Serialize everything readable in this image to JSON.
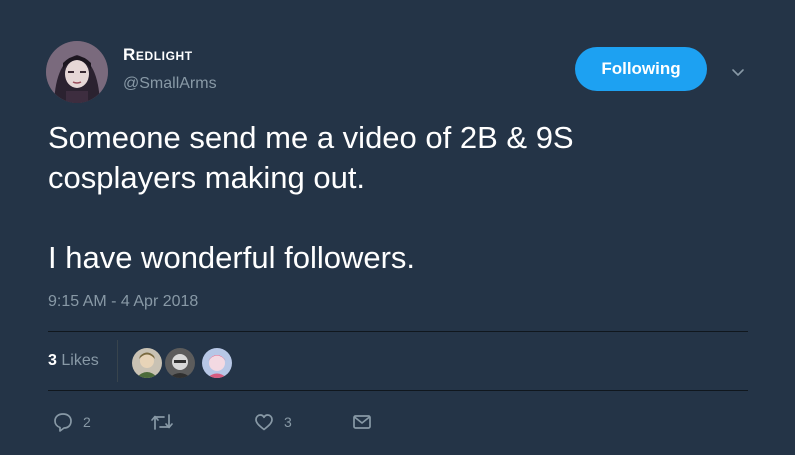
{
  "user": {
    "display_name": "Redlight",
    "handle": "@SmallArms"
  },
  "follow_button": {
    "label": "Following"
  },
  "tweet": {
    "lines": [
      "Someone send me a video of 2B & 9S",
      "cosplayers making out.",
      "I have wonderful followers."
    ],
    "timestamp": "9:15 AM - 4 Apr 2018"
  },
  "likes": {
    "count": "3",
    "label": "Likes"
  },
  "actions": {
    "reply_count": "2",
    "retweet_count": "",
    "like_count": "3"
  },
  "colors": {
    "background": "#243447",
    "accent": "#1da1f2",
    "secondary_text": "#8899a6",
    "divider": "#10171e"
  },
  "icons": {
    "caret": "chevron-down-icon",
    "reply": "reply-icon",
    "retweet": "retweet-icon",
    "like": "heart-icon",
    "dm": "envelope-icon"
  }
}
